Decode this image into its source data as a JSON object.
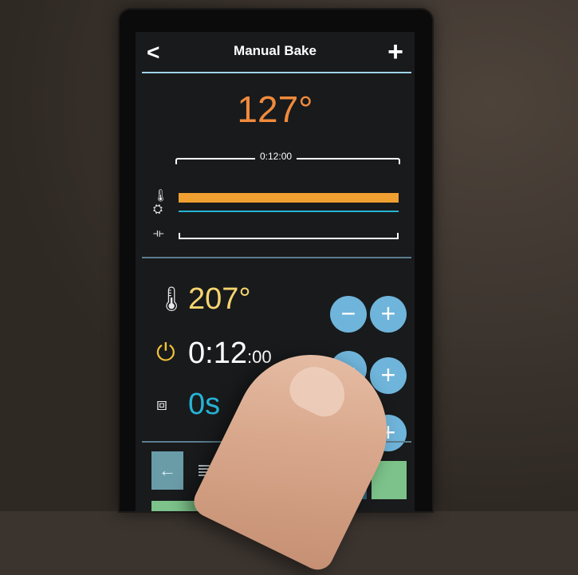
{
  "header": {
    "back": "<",
    "title": "Manual Bake",
    "add": "+"
  },
  "current_temperature": "127°",
  "progress": {
    "time_label": "0:12:00"
  },
  "status_rows": [
    {
      "icon": "thermometer-icon"
    },
    {
      "icon": "fan-icon"
    },
    {
      "icon": "span-icon"
    }
  ],
  "settings": {
    "temperature": {
      "value": "207°",
      "icon": "thermometer-icon"
    },
    "timer": {
      "value": "0:12",
      "suffix": ":00",
      "icon": "clock-icon"
    },
    "steam": {
      "value": "0s",
      "icon": "steam-icon"
    }
  },
  "buttons": {
    "minus": "−",
    "plus": "+"
  },
  "toolbar": {
    "back": "←",
    "list": "≣",
    "adjust": "⫮"
  },
  "colors": {
    "accent_orange": "#f08a3c",
    "setpoint_yellow": "#f7d56e",
    "steam_cyan": "#27b3d6",
    "button_blue": "#6fb4da",
    "divider": "#9ed3ea"
  }
}
